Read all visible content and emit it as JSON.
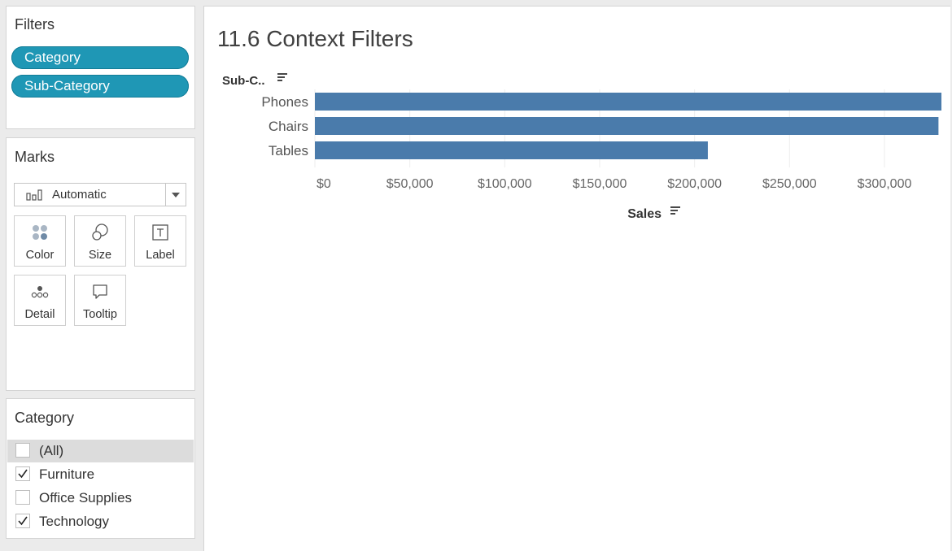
{
  "filters": {
    "title": "Filters",
    "pills": [
      "Category",
      "Sub-Category"
    ]
  },
  "marks": {
    "title": "Marks",
    "mark_type": "Automatic",
    "buttons": [
      {
        "label": "Color",
        "icon": "color-dots-icon"
      },
      {
        "label": "Size",
        "icon": "size-circles-icon"
      },
      {
        "label": "Label",
        "icon": "text-label-icon"
      },
      {
        "label": "Detail",
        "icon": "detail-dots-icon"
      },
      {
        "label": "Tooltip",
        "icon": "speech-bubble-icon"
      }
    ]
  },
  "category_filter": {
    "title": "Category",
    "items": [
      {
        "label": "(All)",
        "checked": false,
        "highlighted": true
      },
      {
        "label": "Furniture",
        "checked": true,
        "highlighted": false
      },
      {
        "label": "Office Supplies",
        "checked": false,
        "highlighted": false
      },
      {
        "label": "Technology",
        "checked": true,
        "highlighted": false
      }
    ]
  },
  "sheet": {
    "title": "11.6 Context Filters"
  },
  "colors": {
    "pill": "#1f97b5",
    "bar": "#4a7bab",
    "gridline": "#eeeeee"
  },
  "chart_data": {
    "type": "bar",
    "orientation": "horizontal",
    "row_header": "Sub-C..",
    "categories": [
      "Phones",
      "Chairs",
      "Tables"
    ],
    "values": [
      330007,
      328449,
      206966
    ],
    "xlabel": "Sales",
    "xlim": [
      0,
      330000
    ],
    "xticks": [
      0,
      50000,
      100000,
      150000,
      200000,
      250000,
      300000
    ],
    "xtick_labels": [
      "$0",
      "$50,000",
      "$100,000",
      "$150,000",
      "$200,000",
      "$250,000",
      "$300,000"
    ],
    "grid": true,
    "legend": "none"
  }
}
